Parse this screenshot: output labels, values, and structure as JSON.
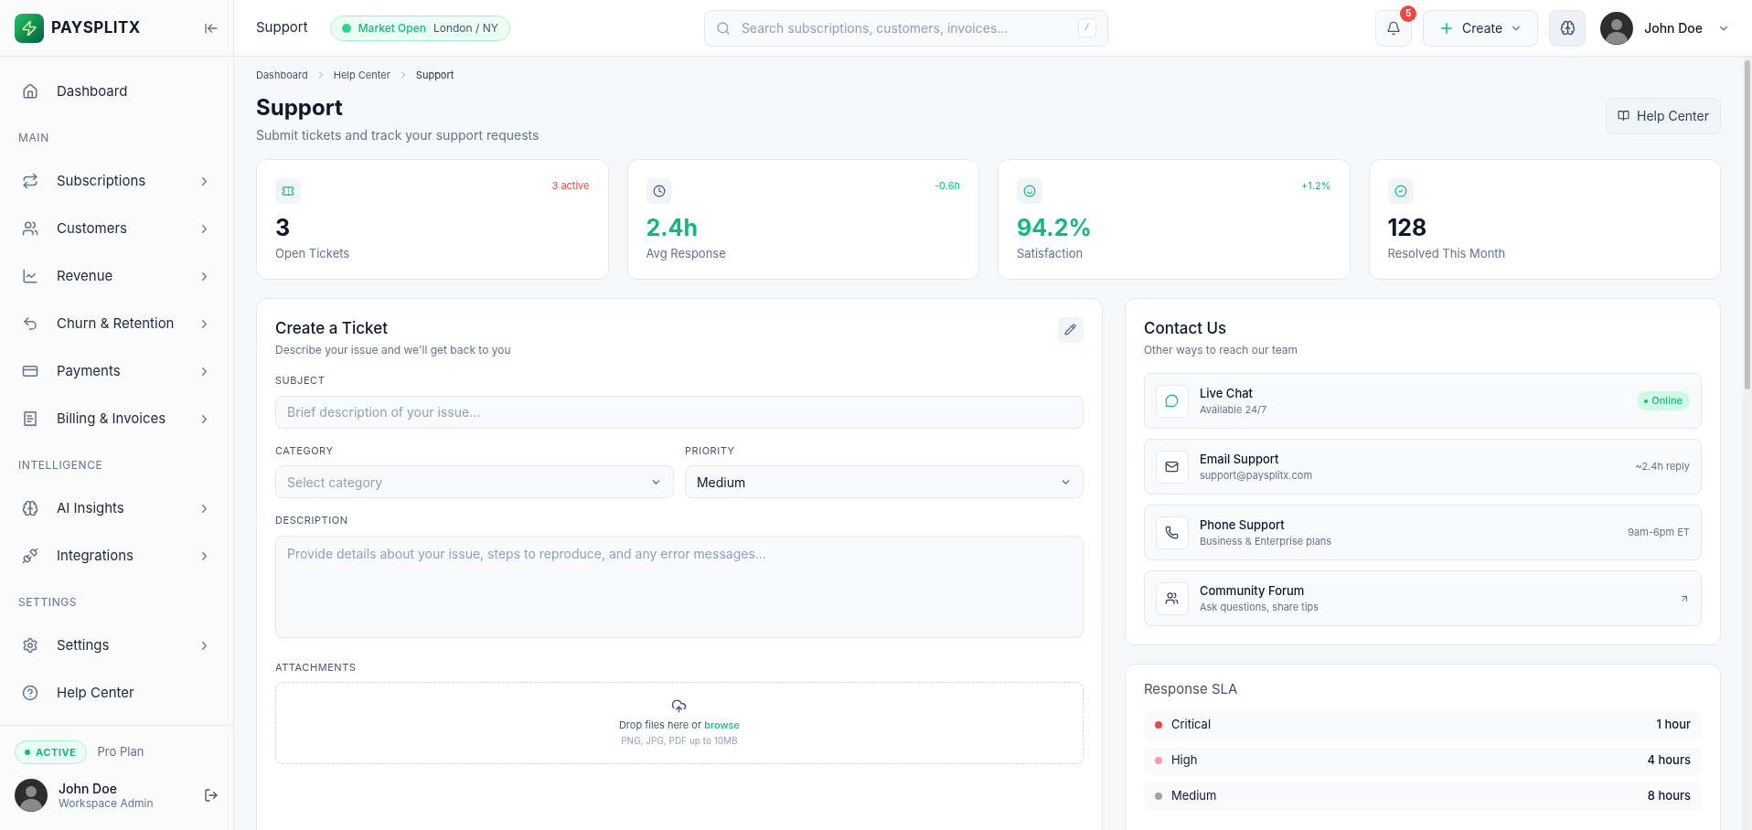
{
  "brand": {
    "name": "PAYSPLITX"
  },
  "sidebar": {
    "sections": [
      {
        "items": [
          {
            "label": "Dashboard",
            "has_submenu": false
          }
        ]
      },
      {
        "heading": "MAIN",
        "items": [
          {
            "label": "Subscriptions",
            "has_submenu": true
          },
          {
            "label": "Customers",
            "has_submenu": true
          },
          {
            "label": "Revenue",
            "has_submenu": true
          },
          {
            "label": "Churn & Retention",
            "has_submenu": true
          },
          {
            "label": "Payments",
            "has_submenu": true
          },
          {
            "label": "Billing & Invoices",
            "has_submenu": true
          }
        ]
      },
      {
        "heading": "INTELLIGENCE",
        "items": [
          {
            "label": "AI Insights",
            "has_submenu": true
          },
          {
            "label": "Integrations",
            "has_submenu": true
          }
        ]
      },
      {
        "heading": "SETTINGS",
        "items": [
          {
            "label": "Settings",
            "has_submenu": true
          },
          {
            "label": "Help Center",
            "has_submenu": false
          }
        ]
      }
    ]
  },
  "plan": {
    "status": "ACTIVE",
    "name": "Pro Plan"
  },
  "sidebar_user": {
    "name": "John Doe",
    "role": "Workspace Admin"
  },
  "topbar": {
    "title": "Support",
    "market": {
      "status": "Market Open",
      "location": "London / NY"
    },
    "search": {
      "placeholder": "Search subscriptions, customers, invoices...",
      "shortcut": "/"
    },
    "notifications": "5",
    "create": "Create",
    "user": "John Doe"
  },
  "breadcrumbs": [
    "Dashboard",
    "Help Center",
    "Support"
  ],
  "page": {
    "title": "Support",
    "subtitle": "Submit tickets and track your support requests",
    "help_button": "Help Center"
  },
  "stats": [
    {
      "value": "3",
      "label": "Open Tickets",
      "delta": {
        "text": "3 active",
        "color": "#ef4444"
      },
      "highlight": false
    },
    {
      "value": "2.4h",
      "label": "Avg Response",
      "delta": {
        "text": "-0.6h",
        "color": "#10b981"
      },
      "highlight": true
    },
    {
      "value": "94.2%",
      "label": "Satisfaction",
      "delta": {
        "text": "+1.2%",
        "color": "#10b981"
      },
      "highlight": true
    },
    {
      "value": "128",
      "label": "Resolved This Month",
      "highlight": false
    }
  ],
  "ticket_form": {
    "title": "Create a Ticket",
    "subtitle": "Describe your issue and we'll get back to you",
    "subject": {
      "label": "SUBJECT",
      "placeholder": "Brief description of your issue..."
    },
    "category": {
      "label": "CATEGORY",
      "placeholder": "Select category"
    },
    "priority": {
      "label": "PRIORITY",
      "value": "Medium"
    },
    "description": {
      "label": "DESCRIPTION",
      "placeholder": "Provide details about your issue, steps to reproduce, and any error messages..."
    },
    "attachments": {
      "label": "ATTACHMENTS",
      "text": "Drop files here or",
      "link": "browse",
      "hint": "PNG, JPG, PDF up to 10MB"
    }
  },
  "contact": {
    "title": "Contact Us",
    "subtitle": "Other ways to reach our team",
    "channels": [
      {
        "name": "Live Chat",
        "detail": "Available 24/7",
        "kind": "badge",
        "aside": "Online"
      },
      {
        "name": "Email Support",
        "detail": "support@paysplitx.com",
        "kind": "text",
        "aside": "~2.4h reply"
      },
      {
        "name": "Phone Support",
        "detail": "Business & Enterprise plans",
        "kind": "text",
        "aside": "9am-6pm ET"
      },
      {
        "name": "Community Forum",
        "detail": "Ask questions, share tips",
        "kind": "link"
      }
    ]
  },
  "sla": {
    "title": "Response SLA",
    "rows": [
      {
        "level": "Critical",
        "time": "1 hour",
        "color": "#ef4444"
      },
      {
        "level": "High",
        "time": "4 hours",
        "color": "#f49ca3"
      },
      {
        "level": "Medium",
        "time": "8 hours",
        "color": "#9ca3af"
      }
    ]
  }
}
